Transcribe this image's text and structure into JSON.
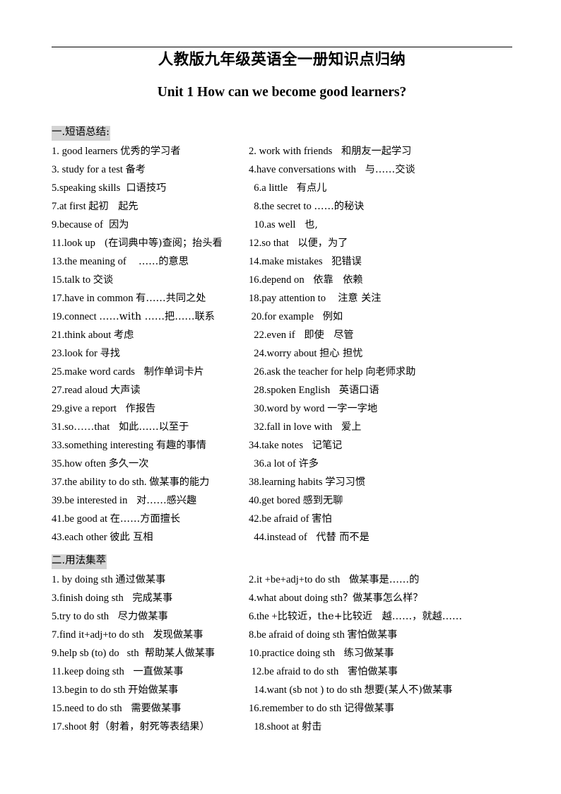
{
  "document": {
    "title": "人教版九年级英语全一册知识点归纳",
    "unit_title": "Unit 1 How can we become good learners?",
    "highlight_color": "#d4d4d4",
    "text_color": "#000000",
    "background_color": "#ffffff"
  },
  "sections": [
    {
      "id": "phrases",
      "header": "一.短语总结:",
      "rows": [
        {
          "a_en": "1. good learners ",
          "a_cn": "优秀的学习者",
          "b_en": "2. work with friends ",
          "b_cn": "  和朋友一起学习"
        },
        {
          "a_en": "3. study for a test ",
          "a_cn": "备考",
          "b_en": "4.have conversations with ",
          "b_cn": "  与……交谈"
        },
        {
          "a_en": "5.speaking skills ",
          "a_cn": " 口语技巧",
          "b_en": "  6.a little ",
          "b_cn": "  有点儿"
        },
        {
          "a_en": "7.at first ",
          "a_cn": "起初   起先",
          "b_en": "  8.the secret to ",
          "b_cn": "……的秘诀"
        },
        {
          "a_en": "9.because of ",
          "a_cn": " 因为",
          "b_en": "  10.as well ",
          "b_cn": "  也,"
        },
        {
          "a_en": "11.look up ",
          "a_cn": "  (在词典中等)查阅；抬头看",
          "b_en": "12.so that ",
          "b_cn": "  以便，为了"
        },
        {
          "a_en": "13.the meaning of ",
          "a_cn": "   ……的意思",
          "b_en": "14.make mistakes ",
          "b_cn": "  犯错误"
        },
        {
          "a_en": "15.talk to ",
          "a_cn": "交谈",
          "b_en": "16.depend on ",
          "b_cn": "  依靠   依赖"
        },
        {
          "a_en": "17.have in common ",
          "a_cn": "有……共同之处",
          "b_en": "18.pay attention to ",
          "b_cn": "   注意 关注"
        },
        {
          "a_en": "19.connect ",
          "a_cn": "……with ……把……联系",
          "b_en": " 20.for example ",
          "b_cn": "  例如"
        },
        {
          "a_en": "21.think about ",
          "a_cn": "考虑",
          "b_en": "  22.even if ",
          "b_cn": "  即使   尽管"
        },
        {
          "a_en": "23.look for ",
          "a_cn": "寻找",
          "b_en": "  24.worry about ",
          "b_cn": "担心 担忧"
        },
        {
          "a_en": "25.make word cards ",
          "a_cn": "  制作单词卡片",
          "b_en": "  26.ask the teacher for help ",
          "b_cn": "向老师求助"
        },
        {
          "a_en": "27.read aloud ",
          "a_cn": "大声读",
          "b_en": "  28.spoken English ",
          "b_cn": "  英语口语"
        },
        {
          "a_en": "29.give a report ",
          "a_cn": "  作报告",
          "b_en": "  30.word by word ",
          "b_cn": "一字一字地"
        },
        {
          "a_en": "31.so……that ",
          "a_cn": "  如此……以至于",
          "b_en": "  32.fall in love with ",
          "b_cn": "  爱上"
        },
        {
          "a_en": "33.something interesting ",
          "a_cn": "有趣的事情",
          "b_en": "34.take notes ",
          "b_cn": "  记笔记"
        },
        {
          "a_en": "35.how often ",
          "a_cn": "多久一次",
          "b_en": "  36.a lot of ",
          "b_cn": "许多"
        },
        {
          "a_en": "37.the ability to do sth. ",
          "a_cn": "做某事的能力",
          "b_en": "38.learning habits ",
          "b_cn": "学习习惯"
        },
        {
          "a_en": "39.be interested in ",
          "a_cn": "  对……感兴趣",
          "b_en": "40.get bored ",
          "b_cn": "感到无聊"
        },
        {
          "a_en": "41.be good at ",
          "a_cn": "在……方面擅长",
          "b_en": "42.be afraid of ",
          "b_cn": "害怕"
        },
        {
          "a_en": "43.each other ",
          "a_cn": "彼此 互相",
          "b_en": "  44.instead of ",
          "b_cn": "  代替 而不是"
        }
      ]
    },
    {
      "id": "usage",
      "header": "二.用法集萃",
      "rows": [
        {
          "a_en": "1. by doing sth ",
          "a_cn": "通过做某事",
          "b_en": "2.it +be+adj+to do sth ",
          "b_cn": "  做某事是……的"
        },
        {
          "a_en": "3.finish doing sth ",
          "a_cn": "  完成某事",
          "b_en": "4.what about doing sth",
          "b_cn": "？做某事怎么样？"
        },
        {
          "a_en": "5.try to do sth ",
          "a_cn": "  尽力做某事",
          "b_en": "6.the +",
          "b_cn": "比较近，the+比较近   越……，就越……"
        },
        {
          "a_en": "7.find it+adj+to do sth ",
          "a_cn": "  发现做某事",
          "b_en": "8.be afraid of doing sth ",
          "b_cn": "害怕做某事"
        },
        {
          "a_en": "9.help sb (to) do   sth ",
          "a_cn": " 帮助某人做某事",
          "b_en": "10.practice doing sth ",
          "b_cn": "  练习做某事"
        },
        {
          "a_en": "11.keep doing sth ",
          "a_cn": "  一直做某事",
          "b_en": " 12.be afraid to do sth ",
          "b_cn": "  害怕做某事"
        },
        {
          "a_en": "13.begin to do sth ",
          "a_cn": "开始做某事",
          "b_en": "  14.want (sb not ) to do sth ",
          "b_cn": "想要(某人不)做某事"
        },
        {
          "a_en": "15.need to do sth ",
          "a_cn": "  需要做某事",
          "b_en": "16.remember to do sth ",
          "b_cn": "记得做某事"
        },
        {
          "a_en": "17.shoot ",
          "a_cn": "射（射着，射死等表结果）",
          "b_en": "  18.shoot at ",
          "b_cn": "射击"
        }
      ]
    }
  ]
}
